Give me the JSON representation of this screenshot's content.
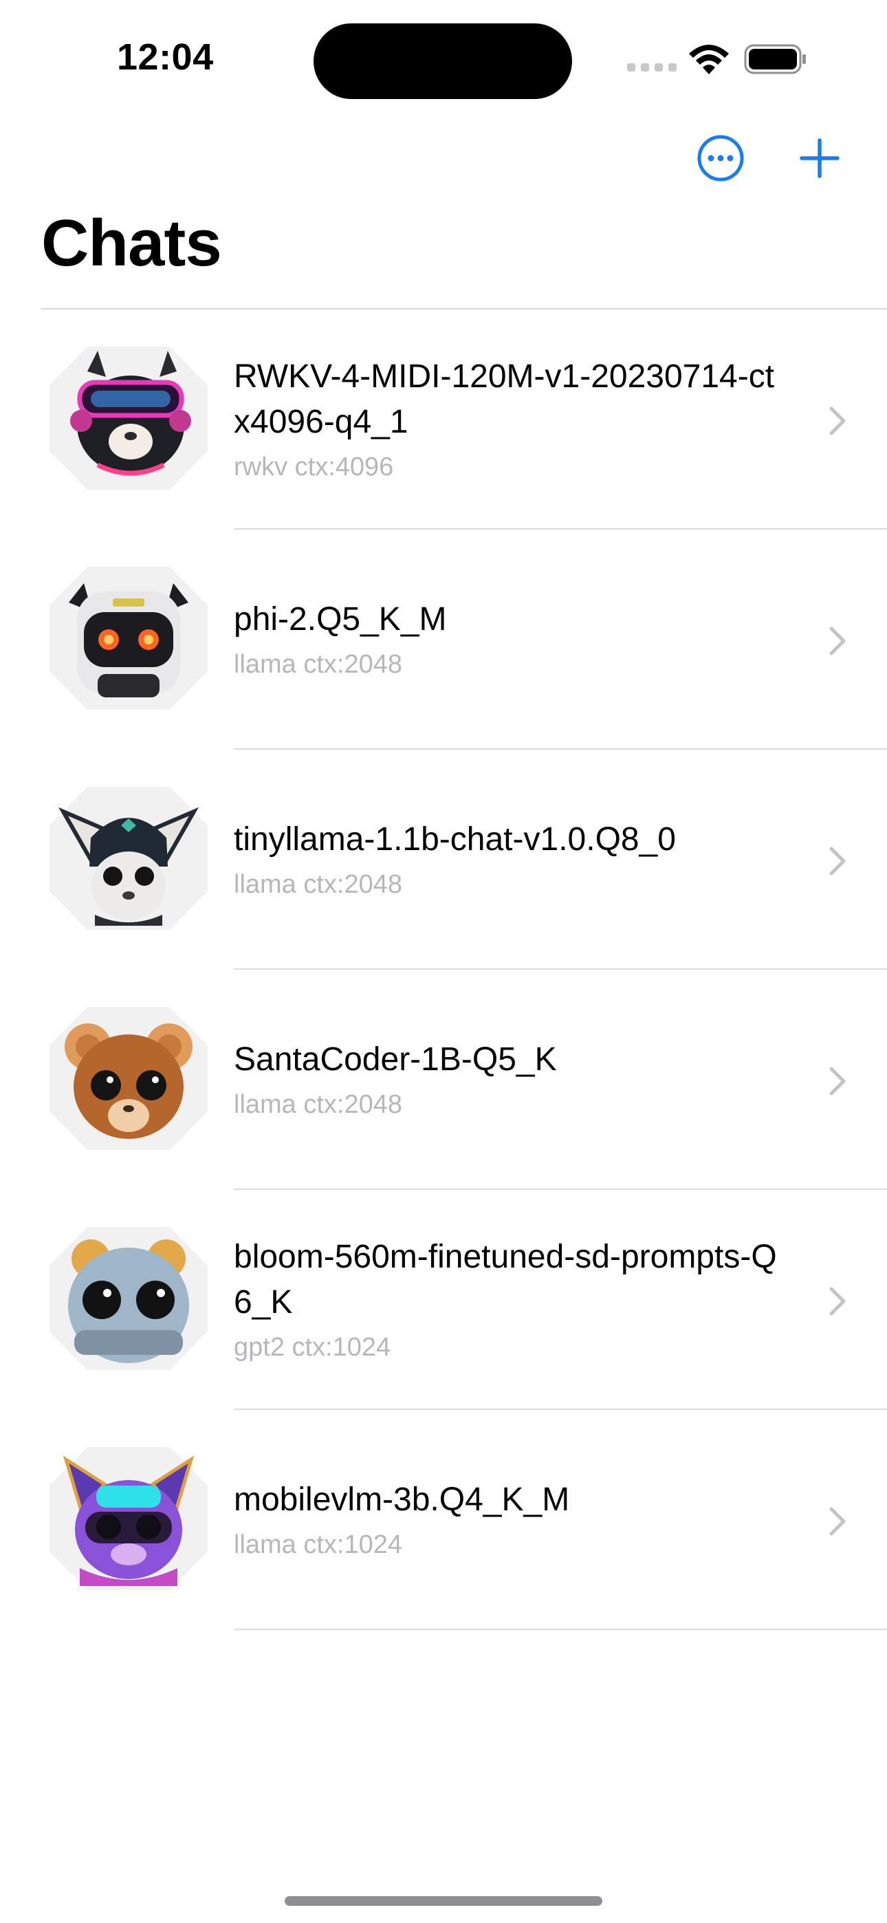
{
  "status_bar": {
    "time": "12:04"
  },
  "nav": {
    "more_icon": "ellipsis-circle-icon",
    "add_icon": "plus-icon"
  },
  "page": {
    "title": "Chats"
  },
  "colors": {
    "accent": "#1a7cf4",
    "secondary_text": "#b6b6bb",
    "divider": "#dcdce0"
  },
  "chats": [
    {
      "name": "RWKV-4-MIDI-120M-v1-20230714-ctx4096-q4_1",
      "meta": "rwkv ctx:4096",
      "avatar": "alpaca-headphones-avatar"
    },
    {
      "name": "phi-2.Q5_K_M",
      "meta": "llama ctx:2048",
      "avatar": "robot-helmet-avatar"
    },
    {
      "name": "tinyllama-1.1b-chat-v1.0.Q8_0",
      "meta": "llama ctx:2048",
      "avatar": "space-alpaca-avatar"
    },
    {
      "name": "SantaCoder-1B-Q5_K",
      "meta": "llama ctx:2048",
      "avatar": "knit-bear-avatar"
    },
    {
      "name": "bloom-560m-finetuned-sd-prompts-Q6_K",
      "meta": "gpt2 ctx:1024",
      "avatar": "knit-blue-bear-avatar"
    },
    {
      "name": "mobilevlm-3b.Q4_K_M",
      "meta": "llama ctx:1024",
      "avatar": "purple-robot-cat-avatar"
    }
  ]
}
